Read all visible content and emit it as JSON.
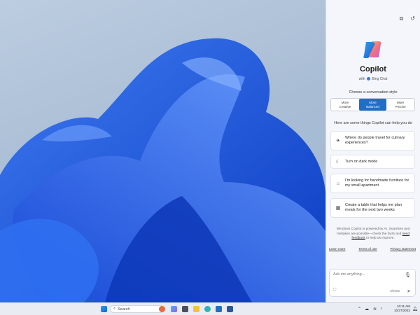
{
  "copilot": {
    "title": "Copilot",
    "subtitle_prefix": "with",
    "subtitle_brand": "Bing Chat",
    "style_label": "Choose a conversation style",
    "styles": [
      {
        "line1": "More",
        "line2": "Creative",
        "active": false
      },
      {
        "line1": "More",
        "line2": "Balanced",
        "active": true
      },
      {
        "line1": "More",
        "line2": "Precise",
        "active": false
      }
    ],
    "help_label": "Here are some things Copilot can help you do",
    "suggestions": [
      {
        "icon": "airplane-icon",
        "glyph": "✈",
        "text": "Where do people travel for culinary experiences?"
      },
      {
        "icon": "moon-icon",
        "glyph": "☾",
        "text": "Turn on dark mode"
      },
      {
        "icon": "tag-icon",
        "glyph": "⌂",
        "text": "I'm looking for handmade furniture for my small apartment"
      },
      {
        "icon": "table-icon",
        "glyph": "▦",
        "text": "Create a table that helps me plan meals for the next two weeks"
      }
    ],
    "disclaimer_pre": "Windows Copilot is powered by AI. Surprises and mistakes are possible—check the facts and",
    "disclaimer_link": "send feedback",
    "disclaimer_post": "to help us improve.",
    "links": [
      "Learn more",
      "Terms of use",
      "Privacy statement"
    ],
    "ask_placeholder": "Ask me anything...",
    "char_counter": "0/4000"
  },
  "taskbar": {
    "search_label": "Search",
    "time": "10:11 AM",
    "date": "10/27/2023"
  },
  "colors": {
    "accent": "#1f6fc8",
    "wallpaper_blue": "#1f5fe6"
  }
}
